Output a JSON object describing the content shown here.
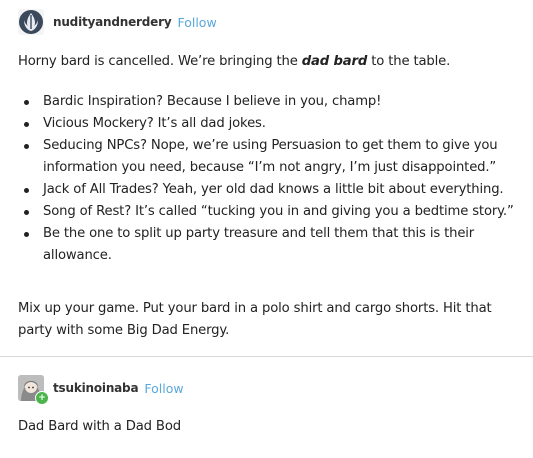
{
  "post1": {
    "username": "nudityandnerdery",
    "follow_label": "Follow",
    "intro_before": "Horny bard is cancelled. We’re bringing the ",
    "intro_emphasis": "dad bard",
    "intro_after": " to the table.",
    "bullets": [
      "Bardic Inspiration? Because I believe in you, champ!",
      "Vicious Mockery? It’s all dad jokes.",
      "Seducing NPCs? Nope, we’re using Persuasion to get them to give you information you need, because “I’m not angry, I’m just disappointed.”",
      "Jack of All Trades? Yeah, yer old dad knows a little bit about everything.",
      "Song of Rest? It’s called “tucking you in and giving you a bedtime story.”",
      "Be the one to split up party treasure and tell them that this is their allowance."
    ],
    "outro": "Mix up your game. Put your bard in a polo shirt and cargo shorts. Hit that party with some Big Dad Energy."
  },
  "post2": {
    "username": "tsukinoinaba",
    "follow_label": "Follow",
    "body": "Dad Bard with a Dad Bod"
  },
  "colors": {
    "follow_link": "#5aa8db",
    "divider": "#d9d9d9",
    "online_badge": "#4ab54a"
  },
  "icons": {
    "post1_avatar": "rebel-alliance-avatar-icon",
    "post2_avatar": "anime-character-avatar-icon",
    "post2_badge": "tumblr-plus-badge-icon"
  }
}
